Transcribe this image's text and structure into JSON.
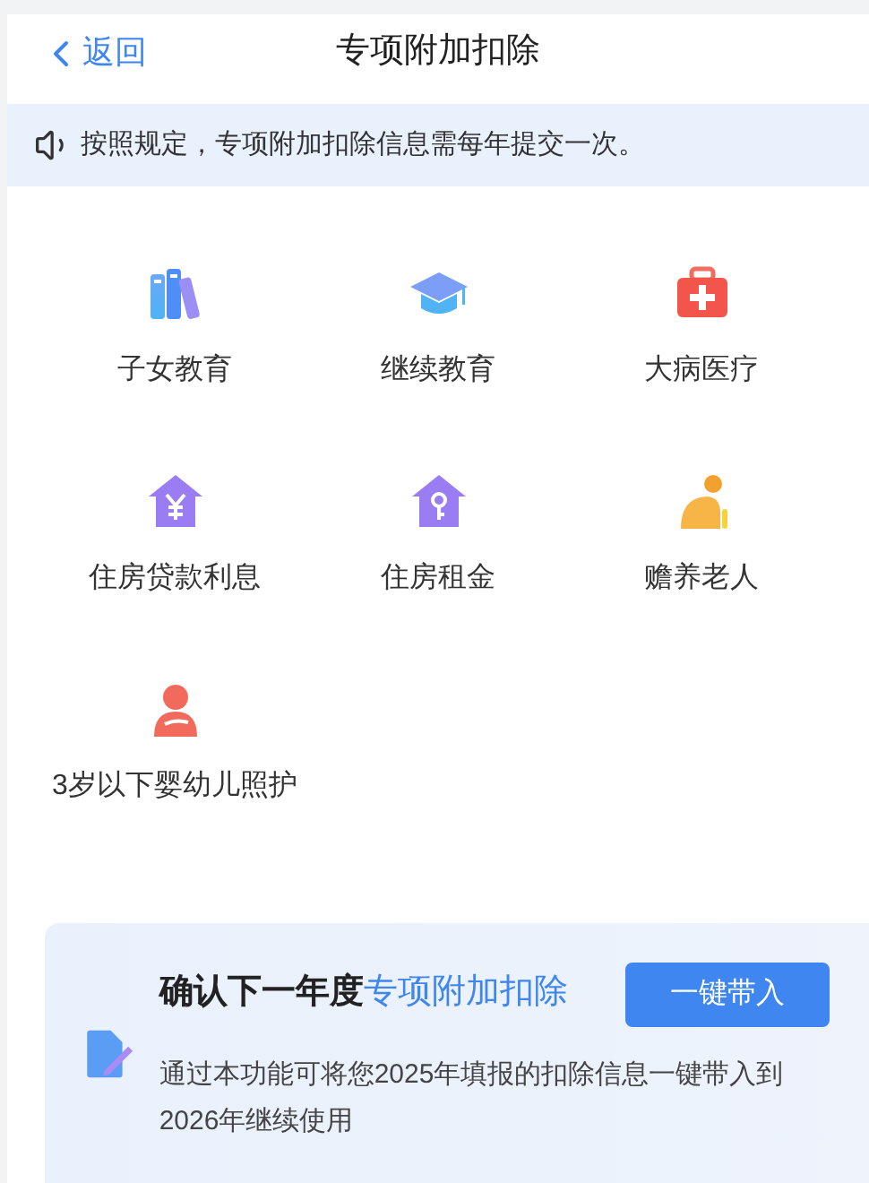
{
  "nav": {
    "back": "返回",
    "title": "专项附加扣除"
  },
  "notice": "按照规定，专项附加扣除信息需每年提交一次。",
  "items": [
    {
      "label": "子女教育",
      "kind": "books"
    },
    {
      "label": "继续教育",
      "kind": "cap"
    },
    {
      "label": "大病医疗",
      "kind": "medkit"
    },
    {
      "label": "住房贷款利息",
      "kind": "loan"
    },
    {
      "label": "住房租金",
      "kind": "rent"
    },
    {
      "label": "赡养老人",
      "kind": "elder"
    },
    {
      "label": "3岁以下婴幼儿照护",
      "kind": "infant"
    }
  ],
  "card": {
    "title_prefix": "确认下一年度",
    "title_highlight": "专项附加扣除",
    "button": "一键带入",
    "description": "通过本功能可将您2025年填报的扣除信息一键带入到2026年继续使用"
  }
}
